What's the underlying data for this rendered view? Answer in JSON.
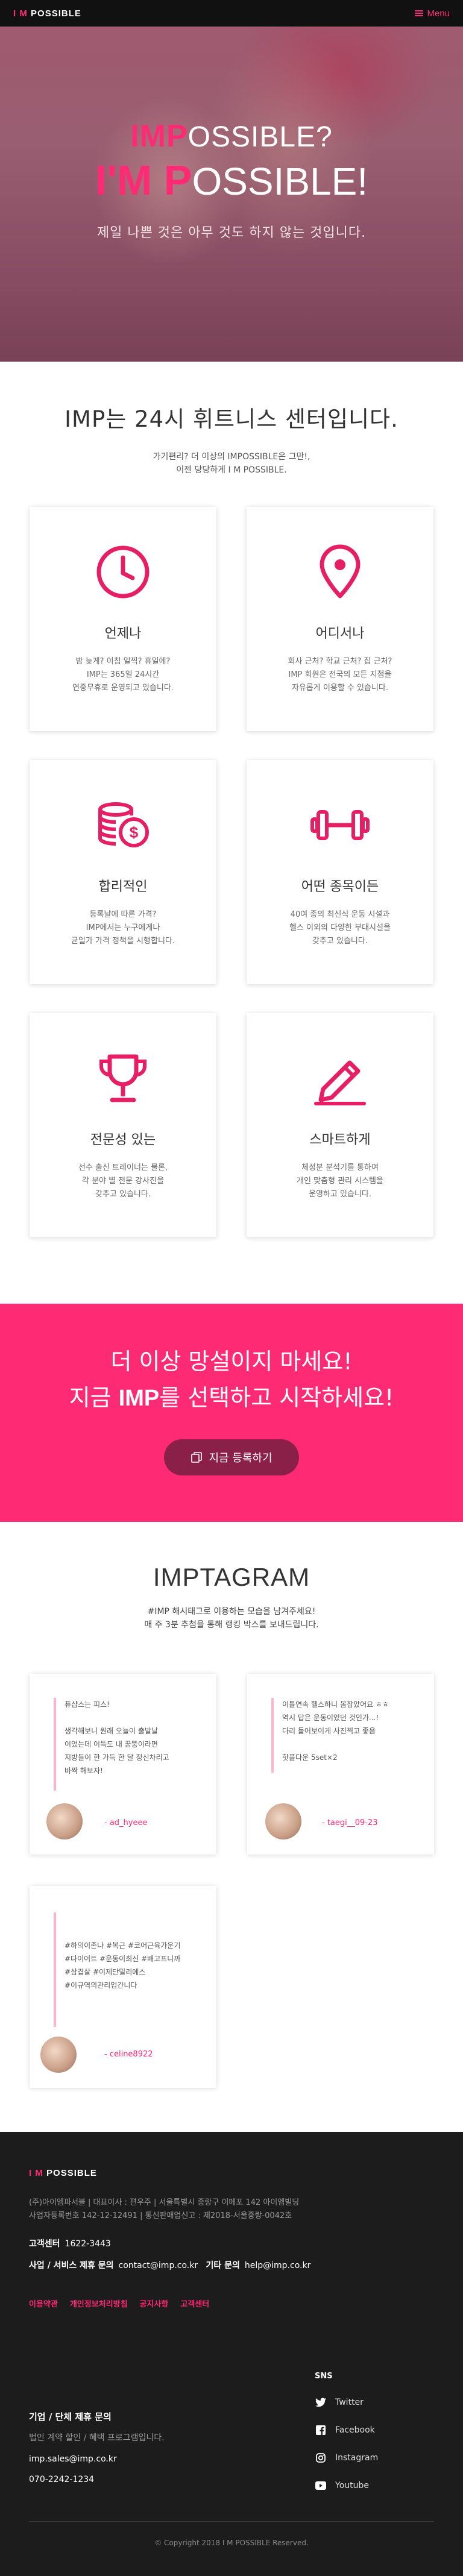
{
  "header": {
    "logo_accent": "I M",
    "logo_rest": "POSSIBLE",
    "menu_label": "Menu"
  },
  "hero": {
    "line1_imp": "IMP",
    "line1_rest": "OSSIBLE?",
    "line2_a": "I'M ",
    "line2_p": "P",
    "line2_rest": "OSSIBLE!",
    "subtitle": "제일 나쁜 것은 아무 것도 하지 않는 것입니다."
  },
  "intro": {
    "title": "IMP는 24시 휘트니스 센터입니다.",
    "desc_line1": "가기편리? 더 이상의 IMPOSSIBLE은 그만!,",
    "desc_line2": "이젠 당당하게 I M POSSIBLE."
  },
  "features": [
    {
      "icon": "clock-icon",
      "title": "언제나",
      "desc": "밤 늦게? 이침 일찍? 휴일에?\nIMP는 365일 24시간\n연중무휴로 운영되고 있습니다."
    },
    {
      "icon": "location-pin-icon",
      "title": "어디서나",
      "desc": "회사 근처? 학교 근처? 집 근처?\nIMP 회원은 전국의 모든 지점을\n자유롭게 이용할 수 있습니다."
    },
    {
      "icon": "coins-icon",
      "title": "합리적인",
      "desc": "등록날에 따른 가격?\nIMP에서는 누구에게나\n균일가 가격 정책을 시행합니다."
    },
    {
      "icon": "dumbbell-icon",
      "title": "어떤 종목이든",
      "desc": "40여 종의 최신식 운동 시설과\n헬스 이외의 다양한 부대시설을\n갖추고 있습니다."
    },
    {
      "icon": "trophy-icon",
      "title": "전문성 있는",
      "desc": "선수 출신 트레이너는 물론,\n각 분야 별 전문 강사진을\n갖추고 있습니다."
    },
    {
      "icon": "pencil-icon",
      "title": "스마트하게",
      "desc": "체성분 분석기를 통하여\n개인 맞춤형 관리 시스템을\n운영하고 있습니다."
    }
  ],
  "cta": {
    "line1": "더 이상 망설이지 마세요!",
    "line2_pre": "지금 ",
    "line2_imp": "IMP",
    "line2_post": "를 선택하고 시작하세요!",
    "button": "지금 등록하기"
  },
  "imptagram": {
    "title": "IMPTAGRAM",
    "desc_line1": "#IMP 해시태그로 이용하는 모습을 남겨주세요!",
    "desc_line2": "매 주 3분 추첨을 통해 랭킹 박스를 보내드립니다.",
    "posts": [
      {
        "lines": [
          "퓨샵스는 피스!",
          "",
          "생각해보니 원래 오늘이 출발날",
          "이었는데 이득도 내 꿈뚱이라면",
          "지방들이 한 가득 한 달 정신차리고",
          "바짝 해보자!"
        ],
        "user": "- ad_hyeee"
      },
      {
        "lines": [
          "이틀연속 헬스하니 몸잡았어요 ㅎㅎ",
          "역시 답은 운동이었던 것인가...!",
          "다리 들어보이게 사진찍고 좋음",
          "",
          "핫플다운 5set×2"
        ],
        "user": "- taegi__09-23"
      },
      {
        "lines": [
          "#하의이존나 #복근 #코어근육가운기",
          "#다이어트 #운동이최신 #배고프니까",
          "#삼겹살 #이제단밀리에스",
          "#이규역의관리입간니다"
        ],
        "user": "- celine8922"
      }
    ]
  },
  "footer": {
    "logo_accent": "I M",
    "logo_rest": "POSSIBLE",
    "info_line1": "(주)아이엠파서블  |  대표이사 : 편우주  |  서울특별시 중랑구 이메포 142 아이엠빌딩",
    "info_line2": "사업자등록번호 142-12-12491  |  통신판매업신고 : 제2018-서울중랑-0042호",
    "cs_label": "고객센터",
    "cs_value": "1622-3443",
    "biz_label": "사업 / 서비스 제휴 문의",
    "biz_value": "contact@imp.co.kr",
    "other_label": "기타 문의",
    "other_value": "help@imp.co.kr",
    "links": [
      "이용약관",
      "개인정보처리방침",
      "공지사항",
      "고객센터"
    ],
    "corp_title": "기업 / 단체 제휴 문의",
    "corp_desc": "법인 계약 할인 / 혜택 프로그램입니다.",
    "corp_mail": "imp.sales@imp.co.kr",
    "corp_phone": "070-2242-1234",
    "sns_title": "SNS",
    "sns": [
      {
        "icon": "twitter-icon",
        "label": "Twitter"
      },
      {
        "icon": "facebook-icon",
        "label": "Facebook"
      },
      {
        "icon": "instagram-icon",
        "label": "Instagram"
      },
      {
        "icon": "youtube-icon",
        "label": "Youtube"
      }
    ],
    "copyright": "© Copyright 2018 I M POSSIBLE Reserved."
  },
  "colors": {
    "accent": "#ff2a74",
    "dark": "#1c1c1c",
    "cta_button": "#8a1f48"
  }
}
